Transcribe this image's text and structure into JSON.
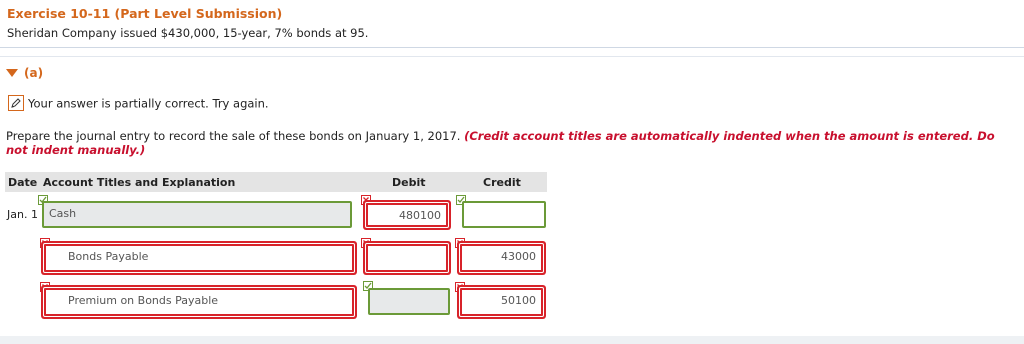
{
  "header": {
    "title": "Exercise 10-11 (Part Level Submission)",
    "subtitle": "Sheridan Company issued $430,000, 15-year, 7% bonds at 95."
  },
  "part": {
    "label": "(a)"
  },
  "status": {
    "message": "Your answer is partially correct.  Try again."
  },
  "instructions": {
    "text": "Prepare the journal entry to record the sale of these bonds on January 1, 2017.",
    "note": "(Credit account titles are automatically indented when the amount is entered. Do not indent manually.)"
  },
  "table": {
    "headers": {
      "date": "Date",
      "account": "Account Titles and Explanation",
      "debit": "Debit",
      "credit": "Credit"
    },
    "rows": [
      {
        "date": "Jan. 1",
        "account": "Cash",
        "debit": "480100",
        "credit": ""
      },
      {
        "date": "",
        "account": "Bonds Payable",
        "debit": "",
        "credit": "43000"
      },
      {
        "date": "",
        "account": "Premium on Bonds Payable",
        "debit": "",
        "credit": "50100"
      }
    ]
  },
  "colors": {
    "accent": "#d4671c",
    "correct": "#6b9a38",
    "incorrect": "#d8232a",
    "note": "#c8102e"
  },
  "icons": {
    "part_toggle": "caret-down-icon",
    "status": "pencil-icon",
    "correct": "check-icon",
    "incorrect": "x-icon"
  }
}
